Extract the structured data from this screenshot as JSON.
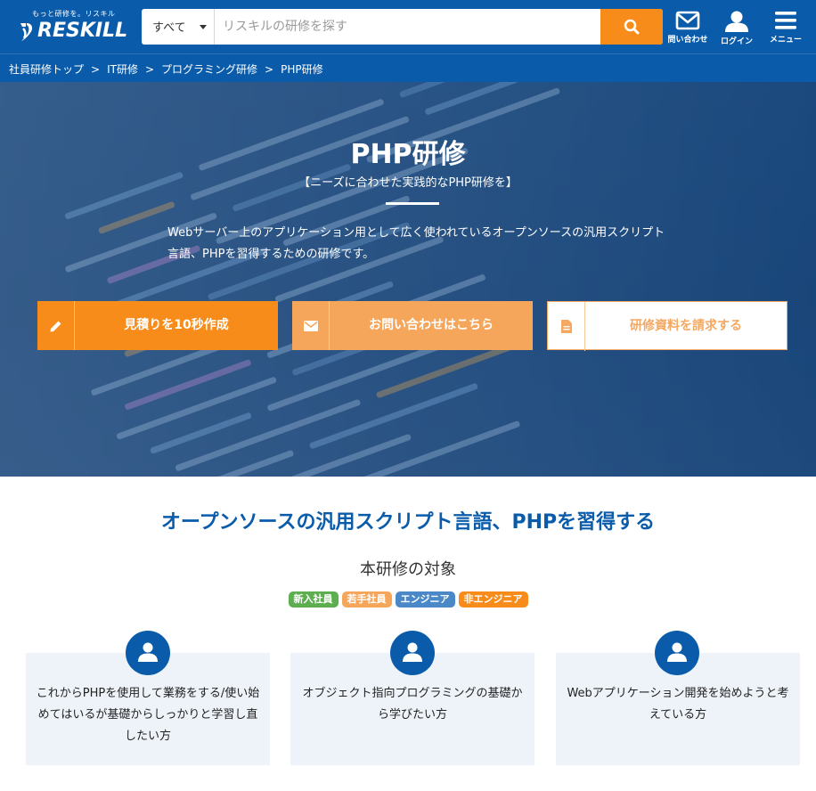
{
  "header": {
    "logo_tagline": "もっと研修を。リスキル",
    "logo_text": "RESKILL",
    "search_scope": "すべて",
    "search_placeholder": "リスキルの研修を探す",
    "contact_label": "問い合わせ",
    "login_label": "ログイン",
    "menu_label": "メニュー"
  },
  "breadcrumb": [
    "社員研修トップ",
    "IT研修",
    "プログラミング研修",
    "PHP研修"
  ],
  "breadcrumb_separator": ">",
  "hero": {
    "title": "PHP研修",
    "subtitle": "【ニーズに合わせた実践的なPHP研修を】",
    "description": "Webサーバー上のアプリケーション用として広く使われているオープンソースの汎用スクリプト言語、PHPを習得するための研修です。",
    "buttons": [
      {
        "label": "見積りを10秒作成",
        "icon": "pencil-icon"
      },
      {
        "label": "お問い合わせはこちら",
        "icon": "envelope-icon"
      },
      {
        "label": "研修資料を請求する",
        "icon": "document-icon"
      }
    ]
  },
  "section": {
    "title": "オープンソースの汎用スクリプト言語、PHPを習得する",
    "target_heading": "本研修の対象",
    "tags": [
      {
        "label": "新入社員",
        "color": "#5cae4f"
      },
      {
        "label": "若手社員",
        "color": "#f6a65a"
      },
      {
        "label": "エンジニア",
        "color": "#4a88c7"
      },
      {
        "label": "非エンジニア",
        "color": "#f78c1a"
      }
    ],
    "cards": [
      {
        "text": "これからPHPを使用して業務をする/使い始めてはいるが基礎からしっかりと学習し直したい方"
      },
      {
        "text": "オブジェクト指向プログラミングの基礎から学びたい方"
      },
      {
        "text": "Webアプリケーション開発を始めようと考えている方"
      }
    ]
  },
  "colors": {
    "brand_blue": "#0a5cab",
    "accent_orange": "#f78c1a",
    "card_bg": "#eef3f9"
  }
}
